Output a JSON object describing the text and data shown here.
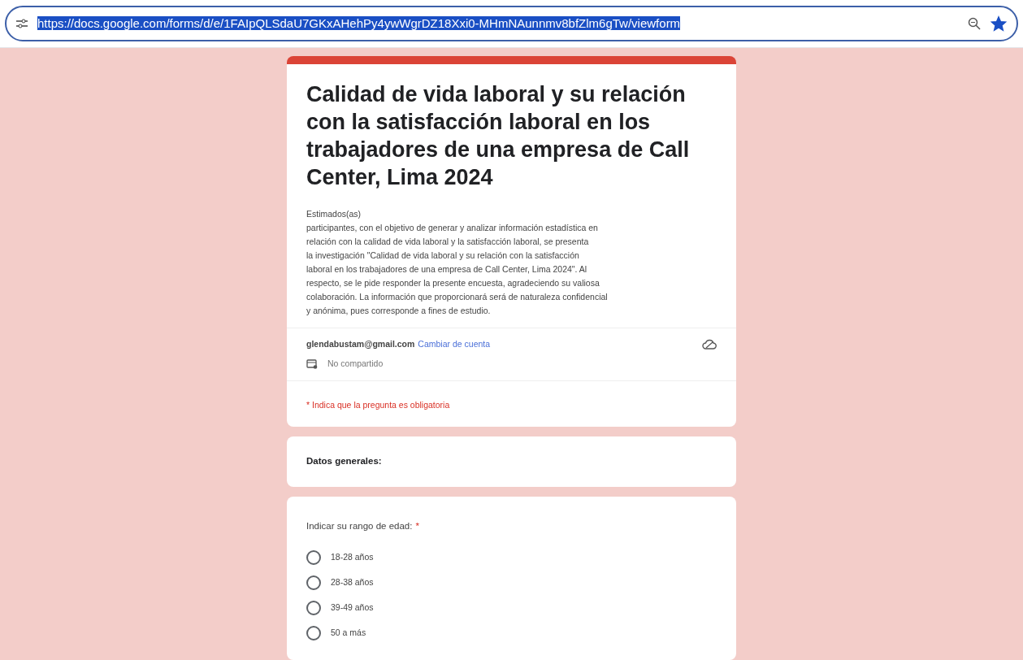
{
  "address_bar": {
    "url": "https://docs.google.com/forms/d/e/1FAIpQLSdaU7GKxAHehPy4ywWgrDZ18Xxi0-MHmNAunnmv8bfZlm6gTw/viewform",
    "selected": true,
    "bookmarked": true
  },
  "form": {
    "title": "Calidad de vida laboral y su relación con la satisfacción laboral en los trabajadores de una empresa de Call Center, Lima 2024",
    "description": "Estimados(as)\nparticipantes, con el objetivo de generar y analizar información estadística en\nrelación con la calidad de vida laboral y la satisfacción laboral, se presenta\nla investigación \"Calidad de vida laboral y su relación con la satisfacción\nlaboral en los trabajadores de una empresa de Call Center, Lima 2024\". Al\nrespecto, se le pide responder la presente encuesta, agradeciendo su valiosa\ncolaboración. La información que proporcionará será de naturaleza confidencial\ny anónima, pues corresponde a fines de estudio.",
    "account": "glendabustam@gmail.com",
    "switch_account": "Cambiar de cuenta",
    "share_status": "No compartido",
    "required_note": "* Indica que la pregunta es obligatoria"
  },
  "section": {
    "title": "Datos generales:"
  },
  "question": {
    "label": "Indicar su rango de edad:",
    "required_mark": "*",
    "options": [
      {
        "label": "18-28 años",
        "selected": false
      },
      {
        "label": "28-38 años",
        "selected": false
      },
      {
        "label": "39-49 años",
        "selected": false
      },
      {
        "label": "50 a más",
        "selected": false
      }
    ]
  }
}
